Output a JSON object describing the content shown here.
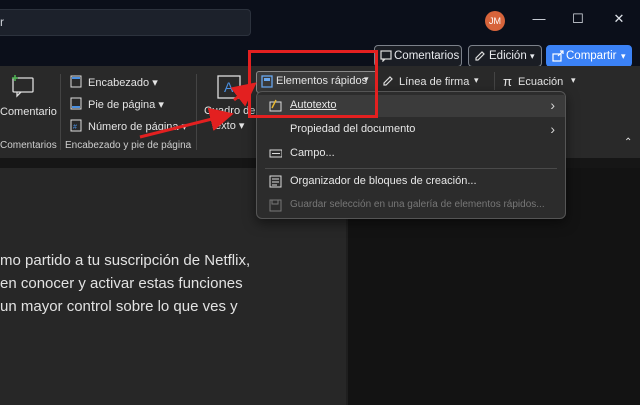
{
  "titlebar": {
    "search_text": "r",
    "avatar_initials": "JM",
    "minimize": "—",
    "maximize": "☐",
    "close": "✕"
  },
  "commandbar": {
    "comments_label": "Comentarios",
    "editing_label": "Edición",
    "share_label": "Compartir",
    "accent": "#3b82f6"
  },
  "ribbon": {
    "comment_label": "Comentario",
    "comments_group": "Comentarios",
    "header_label": "Encabezado",
    "footer_label": "Pie de página",
    "page_number_label": "Número de página",
    "header_footer_group": "Encabezado y pie de página",
    "textbox_label_1": "Cuadro de",
    "textbox_label_2": "texto",
    "quick_parts_label": "Elementos rápidos",
    "signature_line_label": "Línea de firma",
    "equation_label": "Ecuación"
  },
  "menu": {
    "items": [
      {
        "label": "Autotexto",
        "has_submenu": true,
        "enabled": true
      },
      {
        "label": "Propiedad del documento",
        "has_submenu": true,
        "enabled": true
      },
      {
        "label": "Campo...",
        "has_submenu": false,
        "enabled": true
      },
      {
        "label": "Organizador de bloques de creación...",
        "has_submenu": false,
        "enabled": true
      },
      {
        "label": "Guardar selección en una galería de elementos rápidos...",
        "has_submenu": false,
        "enabled": false
      }
    ]
  },
  "document": {
    "lines": [
      "mo partido a tu suscripción de Netflix,",
      "en conocer y activar estas funciones",
      "un mayor control sobre lo que ves y"
    ]
  },
  "annotation_color": "#e32020"
}
